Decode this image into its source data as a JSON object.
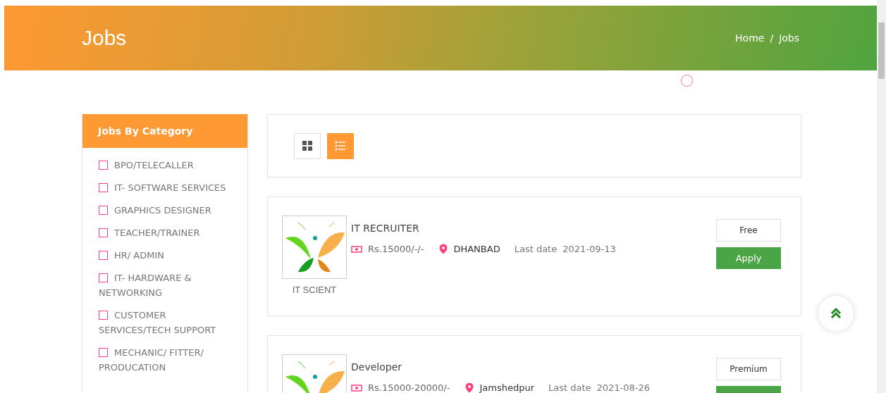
{
  "banner": {
    "title": "Jobs",
    "breadcrumb": [
      "Home",
      "Jobs"
    ],
    "separator": "/"
  },
  "sidebar": {
    "title": "Jobs By Category",
    "items": [
      {
        "label": "BPO/TELECALLER",
        "checked": false
      },
      {
        "label": "IT- SOFTWARE SERVICES",
        "checked": false
      },
      {
        "label": "GRAPHICS DESIGNER",
        "checked": false
      },
      {
        "label": "TEACHER/TRAINER",
        "checked": false
      },
      {
        "label": "HR/ ADMIN",
        "checked": false
      },
      {
        "label": "IT- HARDWARE & NETWORKING",
        "checked": false
      },
      {
        "label": "CUSTOMER SERVICES/TECH SUPPORT",
        "checked": false
      },
      {
        "label": "MECHANIC/ FITTER/ PRODUCATION",
        "checked": false
      }
    ]
  },
  "view_toggles": [
    {
      "kind": "grid",
      "selected": false
    },
    {
      "kind": "list",
      "selected": true
    }
  ],
  "jobs": [
    {
      "title": "IT RECRUITER",
      "salary": "Rs.15000/-/-",
      "location": "DHANBAD",
      "date_label": "Last date",
      "date": "2021-09-13",
      "company": "IT SCIENT",
      "plan": "Free",
      "action": "Apply"
    },
    {
      "title": "Developer",
      "salary": "Rs.15000-20000/-",
      "location": "Jamshedpur",
      "date_label": "Last date",
      "date": "2021-08-26",
      "plan": "Premium"
    }
  ]
}
